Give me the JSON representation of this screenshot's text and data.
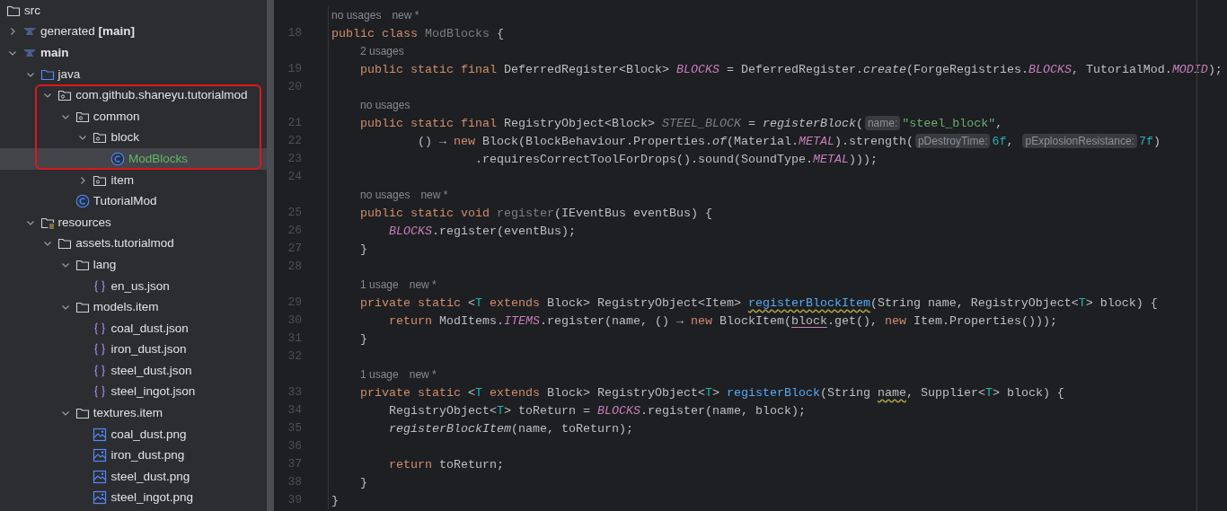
{
  "project_tree": {
    "items": [
      {
        "name": "src",
        "kind": "folder",
        "selected": false,
        "children": [
          {
            "name": "generated **[main]**",
            "kind": "module",
            "expanded": false,
            "selected": false
          },
          {
            "name": "main",
            "kind": "module",
            "expanded": true,
            "bold": true,
            "selected": false,
            "children": [
              {
                "name": "java",
                "kind": "source_folder",
                "expanded": true,
                "selected": false,
                "children": [
                  {
                    "name": "com.github.shaneyu.tutorialmod",
                    "kind": "package",
                    "expanded": true,
                    "highlighted": true,
                    "selected": false,
                    "children": [
                      {
                        "name": "common",
                        "kind": "package",
                        "expanded": true,
                        "highlighted": true,
                        "selected": false,
                        "children": [
                          {
                            "name": "block",
                            "kind": "package",
                            "expanded": true,
                            "highlighted": true,
                            "selected": false,
                            "children": [
                              {
                                "name": "ModBlocks",
                                "kind": "class",
                                "highlighted": true,
                                "color": "#5fb865",
                                "selected": true
                              }
                            ]
                          },
                          {
                            "name": "item",
                            "kind": "package",
                            "expanded": false,
                            "selected": false
                          }
                        ]
                      },
                      {
                        "name": "TutorialMod",
                        "kind": "class",
                        "selected": false
                      }
                    ]
                  }
                ]
              },
              {
                "name": "resources",
                "kind": "resources_folder",
                "expanded": true,
                "selected": false,
                "children": [
                  {
                    "name": "assets.tutorialmod",
                    "kind": "folder",
                    "expanded": true,
                    "selected": false,
                    "children": [
                      {
                        "name": "lang",
                        "kind": "folder",
                        "expanded": true,
                        "selected": false,
                        "children": [
                          {
                            "name": "en_us.json",
                            "kind": "json",
                            "selected": false
                          }
                        ]
                      },
                      {
                        "name": "models.item",
                        "kind": "folder",
                        "expanded": true,
                        "selected": false,
                        "children": [
                          {
                            "name": "coal_dust.json",
                            "kind": "json",
                            "selected": false
                          },
                          {
                            "name": "iron_dust.json",
                            "kind": "json",
                            "selected": false
                          },
                          {
                            "name": "steel_dust.json",
                            "kind": "json",
                            "selected": false
                          },
                          {
                            "name": "steel_ingot.json",
                            "kind": "json",
                            "selected": false
                          }
                        ]
                      },
                      {
                        "name": "textures.item",
                        "kind": "folder",
                        "expanded": true,
                        "selected": false,
                        "children": [
                          {
                            "name": "coal_dust.png",
                            "kind": "image",
                            "selected": false
                          },
                          {
                            "name": "iron_dust.png",
                            "kind": "image",
                            "selected": false
                          },
                          {
                            "name": "steel_dust.png",
                            "kind": "image",
                            "selected": false
                          },
                          {
                            "name": "steel_ingot.png",
                            "kind": "image",
                            "selected": false
                          }
                        ]
                      }
                    ]
                  }
                ]
              }
            ]
          }
        ]
      }
    ]
  },
  "editor": {
    "lines": [
      {
        "kind": "hint",
        "labels": [
          "no usages",
          "new *"
        ]
      },
      {
        "kind": "code",
        "number": "18",
        "tokens": [
          {
            "kind": "keyword",
            "text": "public class "
          },
          {
            "kind": "unused",
            "text": "ModBlocks"
          },
          {
            "kind": "plain",
            "text": " {"
          }
        ]
      },
      {
        "kind": "hint",
        "labels": [
          "2 usages"
        ]
      },
      {
        "kind": "code",
        "number": "19",
        "tokens": [
          {
            "kind": "keyword",
            "text": "    public static final "
          },
          {
            "kind": "plain",
            "text": "DeferredRegister<Block> "
          },
          {
            "kind": "field",
            "text": "BLOCKS"
          },
          {
            "kind": "plain",
            "text": " = DeferredRegister."
          },
          {
            "kind": "italic",
            "text": "create"
          },
          {
            "kind": "plain",
            "text": "(ForgeRegistries."
          },
          {
            "kind": "field",
            "text": "BLOCKS"
          },
          {
            "kind": "plain",
            "text": ", TutorialMod."
          },
          {
            "kind": "field",
            "text": "MODID"
          },
          {
            "kind": "plain",
            "text": ");"
          }
        ]
      },
      {
        "kind": "code",
        "number": "20"
      },
      {
        "kind": "hint",
        "labels": [
          "no usages"
        ]
      },
      {
        "kind": "code",
        "number": "21",
        "tokens": [
          {
            "kind": "keyword",
            "text": "    public static final "
          },
          {
            "kind": "plain",
            "text": "RegistryObject<Block> "
          },
          {
            "kind": "unused_field",
            "text": "STEEL_BLOCK"
          },
          {
            "kind": "plain",
            "text": " = "
          },
          {
            "kind": "italic",
            "text": "registerBlock"
          },
          {
            "kind": "plain",
            "text": "("
          },
          {
            "kind": "inlay",
            "text": "name:"
          },
          {
            "kind": "string",
            "text": "\"steel_block\""
          },
          {
            "kind": "plain",
            "text": ","
          }
        ]
      },
      {
        "kind": "code",
        "number": "22",
        "tokens": [
          {
            "kind": "plain",
            "text": "            () → "
          },
          {
            "kind": "keyword",
            "text": "new "
          },
          {
            "kind": "plain",
            "text": "Block(BlockBehaviour.Properties."
          },
          {
            "kind": "italic",
            "text": "of"
          },
          {
            "kind": "plain",
            "text": "(Material."
          },
          {
            "kind": "field",
            "text": "METAL"
          },
          {
            "kind": "plain",
            "text": ").strength("
          },
          {
            "kind": "inlay",
            "text": "pDestroyTime:"
          },
          {
            "kind": "number",
            "text": "6f"
          },
          {
            "kind": "plain",
            "text": ", "
          },
          {
            "kind": "inlay",
            "text": "pExplosionResistance:"
          },
          {
            "kind": "number",
            "text": "7f"
          },
          {
            "kind": "plain",
            "text": ")"
          }
        ]
      },
      {
        "kind": "code",
        "number": "23",
        "tokens": [
          {
            "kind": "plain",
            "text": "                    .requiresCorrectToolForDrops().sound(SoundType."
          },
          {
            "kind": "field",
            "text": "METAL"
          },
          {
            "kind": "plain",
            "text": ")));"
          }
        ]
      },
      {
        "kind": "code",
        "number": "24"
      },
      {
        "kind": "hint",
        "labels": [
          "no usages",
          "new *"
        ]
      },
      {
        "kind": "code",
        "number": "25",
        "tokens": [
          {
            "kind": "keyword",
            "text": "    public static void "
          },
          {
            "kind": "unused",
            "text": "register"
          },
          {
            "kind": "plain",
            "text": "(IEventBus eventBus) {"
          }
        ]
      },
      {
        "kind": "code",
        "number": "26",
        "tokens": [
          {
            "kind": "field",
            "text": "        BLOCKS"
          },
          {
            "kind": "plain",
            "text": ".register(eventBus);"
          }
        ]
      },
      {
        "kind": "code",
        "number": "27",
        "tokens": [
          {
            "kind": "plain",
            "text": "    }"
          }
        ]
      },
      {
        "kind": "code",
        "number": "28"
      },
      {
        "kind": "hint",
        "labels": [
          "1 usage",
          "new *"
        ]
      },
      {
        "kind": "code",
        "number": "29",
        "tokens": [
          {
            "kind": "keyword",
            "text": "    private static "
          },
          {
            "kind": "plain",
            "text": "<"
          },
          {
            "kind": "type_param",
            "text": "T"
          },
          {
            "kind": "keyword",
            "text": " extends "
          },
          {
            "kind": "plain",
            "text": "Block> RegistryObject<Item> "
          },
          {
            "kind": "method",
            "text": "registerBlockItem",
            "wavy": true
          },
          {
            "kind": "plain",
            "text": "(String name, RegistryObject<"
          },
          {
            "kind": "type_param",
            "text": "T"
          },
          {
            "kind": "plain",
            "text": "> block) {"
          }
        ]
      },
      {
        "kind": "code",
        "number": "30",
        "tokens": [
          {
            "kind": "keyword",
            "text": "        return "
          },
          {
            "kind": "plain",
            "text": "ModItems."
          },
          {
            "kind": "field",
            "text": "ITEMS"
          },
          {
            "kind": "plain",
            "text": ".register(name, () → "
          },
          {
            "kind": "keyword",
            "text": "new "
          },
          {
            "kind": "plain",
            "text": "BlockItem("
          },
          {
            "kind": "plain",
            "text": "block",
            "underline": true
          },
          {
            "kind": "plain",
            "text": ".get(), "
          },
          {
            "kind": "keyword",
            "text": "new "
          },
          {
            "kind": "plain",
            "text": "Item.Properties()));"
          }
        ]
      },
      {
        "kind": "code",
        "number": "31",
        "tokens": [
          {
            "kind": "plain",
            "text": "    }"
          }
        ]
      },
      {
        "kind": "code",
        "number": "32"
      },
      {
        "kind": "hint",
        "labels": [
          "1 usage",
          "new *"
        ]
      },
      {
        "kind": "code",
        "number": "33",
        "tokens": [
          {
            "kind": "keyword",
            "text": "    private static "
          },
          {
            "kind": "plain",
            "text": "<"
          },
          {
            "kind": "type_param",
            "text": "T"
          },
          {
            "kind": "keyword",
            "text": " extends "
          },
          {
            "kind": "plain",
            "text": "Block> RegistryObject<"
          },
          {
            "kind": "type_param",
            "text": "T"
          },
          {
            "kind": "plain",
            "text": "> "
          },
          {
            "kind": "method",
            "text": "registerBlock"
          },
          {
            "kind": "plain",
            "text": "(String "
          },
          {
            "kind": "plain",
            "text": "name",
            "wavy": true
          },
          {
            "kind": "plain",
            "text": ", Supplier<"
          },
          {
            "kind": "type_param",
            "text": "T"
          },
          {
            "kind": "plain",
            "text": "> block) {"
          }
        ]
      },
      {
        "kind": "code",
        "number": "34",
        "tokens": [
          {
            "kind": "plain",
            "text": "        RegistryObject<"
          },
          {
            "kind": "type_param",
            "text": "T"
          },
          {
            "kind": "plain",
            "text": "> toReturn = "
          },
          {
            "kind": "field",
            "text": "BLOCKS"
          },
          {
            "kind": "plain",
            "text": ".register(name, block);"
          }
        ]
      },
      {
        "kind": "code",
        "number": "35",
        "tokens": [
          {
            "kind": "italic",
            "text": "        registerBlockItem"
          },
          {
            "kind": "plain",
            "text": "(name, toReturn);"
          }
        ]
      },
      {
        "kind": "code",
        "number": "36"
      },
      {
        "kind": "code",
        "number": "37",
        "tokens": [
          {
            "kind": "keyword",
            "text": "        return "
          },
          {
            "kind": "plain",
            "text": "toReturn;"
          }
        ]
      },
      {
        "kind": "code",
        "number": "38",
        "tokens": [
          {
            "kind": "plain",
            "text": "    }"
          }
        ]
      },
      {
        "kind": "code",
        "number": "39",
        "tokens": [
          {
            "kind": "plain",
            "text": "}"
          }
        ]
      }
    ]
  }
}
